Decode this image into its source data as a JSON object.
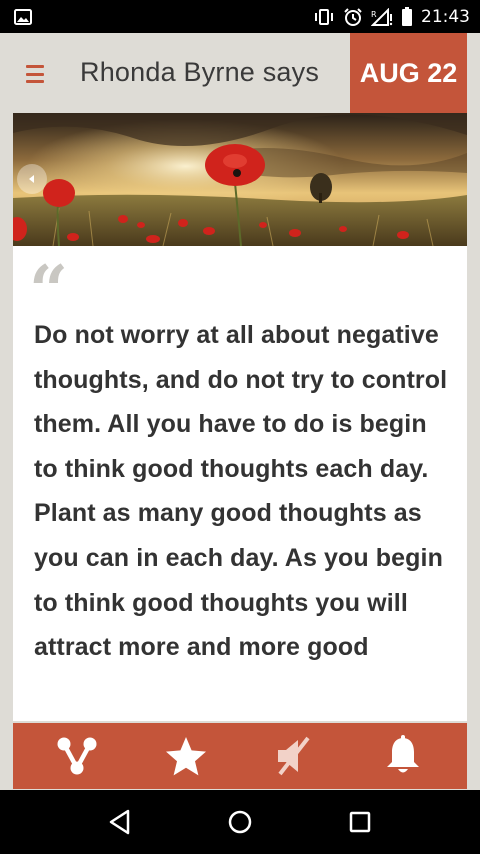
{
  "status_bar": {
    "time": "21:43",
    "icons": [
      "image-icon",
      "vibrate-icon",
      "alarm-icon",
      "signal-icon",
      "battery-icon"
    ]
  },
  "header": {
    "title": "Rhonda Byrne says",
    "date": "AUG 22",
    "menu_icon": "hamburger-icon"
  },
  "card": {
    "quote_mark": "“",
    "quote_text": "Do not worry at all about negative thoughts, and do not try to control them. All you have to do is begin to think good thoughts each day. Plant as many good thoughts as you can in each day. As you begin to think good thoughts you will attract more and more good"
  },
  "actions": [
    "share-icon",
    "star-icon",
    "mute-icon",
    "bell-icon"
  ],
  "nav": [
    "back-icon",
    "home-icon",
    "recents-icon"
  ],
  "colors": {
    "accent": "#c4553a",
    "background": "#dedcd6",
    "text": "#333333"
  }
}
